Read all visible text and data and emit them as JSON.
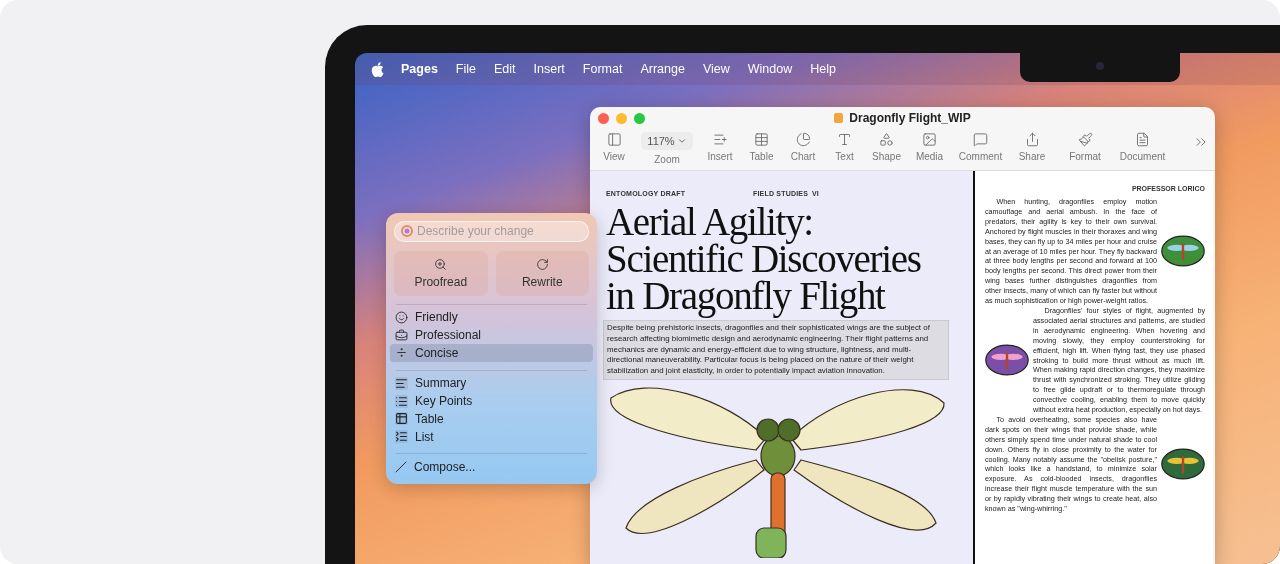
{
  "menubar": {
    "app_name": "Pages",
    "menus": [
      "File",
      "Edit",
      "Insert",
      "Format",
      "Arrange",
      "View",
      "Window",
      "Help"
    ]
  },
  "window": {
    "title": "Dragonfly Flight_WIP",
    "zoom": "117%",
    "toolbar": [
      {
        "label": "View"
      },
      {
        "label": "Zoom"
      },
      {
        "label": "Insert"
      },
      {
        "label": "Table"
      },
      {
        "label": "Chart"
      },
      {
        "label": "Text"
      },
      {
        "label": "Shape"
      },
      {
        "label": "Media"
      },
      {
        "label": "Comment"
      },
      {
        "label": "Share"
      },
      {
        "label": "Format"
      },
      {
        "label": "Document"
      }
    ]
  },
  "writing_tools": {
    "placeholder": "Describe your change",
    "actions": [
      "Proofread",
      "Rewrite"
    ],
    "tones": [
      {
        "label": "Friendly",
        "selected": false
      },
      {
        "label": "Professional",
        "selected": false
      },
      {
        "label": "Concise",
        "selected": true
      }
    ],
    "formats": [
      {
        "label": "Summary"
      },
      {
        "label": "Key Points"
      },
      {
        "label": "Table"
      },
      {
        "label": "List"
      }
    ],
    "compose": "Compose..."
  },
  "document": {
    "left_page": {
      "header": [
        "ENTOMOLOGY DRAFT",
        "FIELD STUDIES",
        "VI"
      ],
      "title_lines": [
        "Aerial Agility:",
        "Scientific Discoveries",
        "in Dragonfly Flight"
      ],
      "abstract": {
        "text": "Despite being prehistoric insects, dragonflies and their sophisticated wings are the subject of research affecting biomimetic design and aerodynamic engineering. Their flight patterns and mechanics are dynamic and energy-efficient due to wing structure, lightness, and multi-directional maneuverability. Particular focus is being placed on the nature of their weight stabilization and joint elasticity, in order to potentially impact aviation innovation.",
        "selected": true
      }
    },
    "right_page": {
      "header": "PROFESSOR LORICO",
      "paragraphs": [
        "When hunting, dragonflies employ motion camouflage and aerial ambush. In the face of predators, their agility is key to their own survival. Anchored by flight muscles in their thoraxes and wing bases, they can fly up to 34 miles per hour and cruise at an average of 10 miles per hour. They fly backward at three body lengths per second and forward at 100 body lengths per second. This direct power from their wing bases further distinguishes dragonflies from other insects, many of which can fly faster but without as much sophistication or high power-weight ratios.",
        "Dragonflies' four styles of flight, augmented by associated aerial structures and patterns, are studied in aerodynamic engineering. When hovering and moving slowly, they employ counterstroking for efficient, high lift. When flying fast, they use phased stroking to build more thrust without as much lift. When making rapid direction changes, they maximize thrust with synchronized stroking. They utilize gliding to free glide updraft or to thermoregulate through convective cooling, enabling them to move quickly without extra heat production, especially on hot days.",
        "To avoid overheating, some species also have dark spots on their wings that provide shade, while others simply spend time under natural shade to cool down. Others fly in close proximity to the water for cooling. Many notably assume the \"obelisk posture,\" which looks like a handstand, to minimize solar exposure. As cold-blooded insects, dragonflies increase their flight muscle temperature with the sun or by rapidly vibrating their wings to create heat, also known as \"wing-whirring.\""
      ]
    }
  }
}
